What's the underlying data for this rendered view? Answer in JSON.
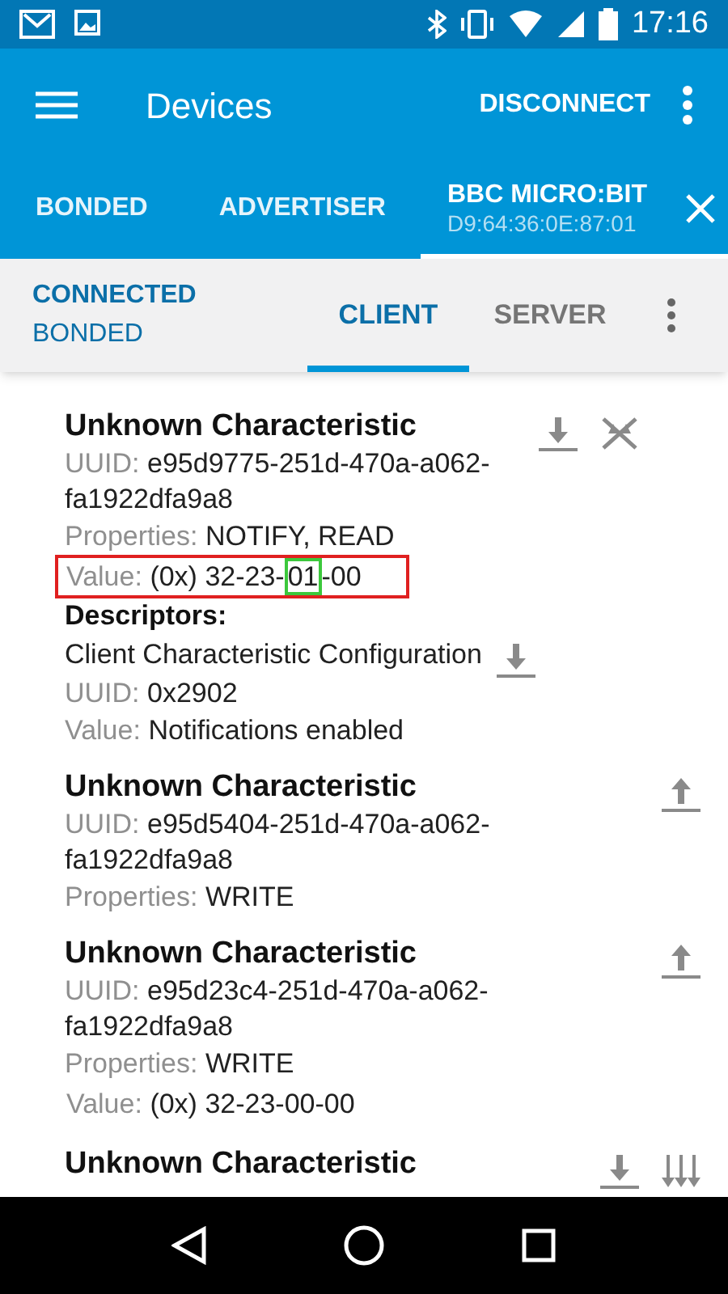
{
  "status_bar": {
    "time": "17:16"
  },
  "app_bar": {
    "title": "Devices",
    "action": "DISCONNECT"
  },
  "device_tabs": [
    {
      "label": "BONDED",
      "selected": false
    },
    {
      "label": "ADVERTISER",
      "selected": false
    },
    {
      "label": "BBC MICRO:BIT",
      "address": "D9:64:36:0E:87:01",
      "selected": true,
      "closable": true
    }
  ],
  "connection": {
    "state": "CONNECTED",
    "bond": "BONDED"
  },
  "tabs": [
    {
      "label": "CLIENT",
      "selected": true
    },
    {
      "label": "SERVER",
      "selected": false
    }
  ],
  "characteristics": [
    {
      "name": "Unknown Characteristic",
      "uuid_label": "UUID:",
      "uuid": "e95d9775-251d-470a-a062-fa1922dfa9a8",
      "properties_label": "Properties:",
      "properties": "NOTIFY, READ",
      "value_label": "Value:",
      "value_boxed": true,
      "value_parts": [
        {
          "text": "(0x) 32-23-",
          "marked": false
        },
        {
          "text": "01",
          "marked": true
        },
        {
          "text": "-00",
          "marked": false
        }
      ],
      "actions": [
        {
          "kind": "read"
        },
        {
          "kind": "notify_off"
        }
      ],
      "descriptors_label": "Descriptors:",
      "descriptors": [
        {
          "name": "Client Characteristic Configuration",
          "uuid_label": "UUID:",
          "uuid": "0x2902",
          "value_label": "Value:",
          "value": "Notifications enabled",
          "actions": [
            {
              "kind": "read"
            }
          ]
        }
      ]
    },
    {
      "name": "Unknown Characteristic",
      "uuid_label": "UUID:",
      "uuid": "e95d5404-251d-470a-a062-fa1922dfa9a8",
      "properties_label": "Properties:",
      "properties": "WRITE",
      "actions": [
        {
          "kind": "write"
        }
      ]
    },
    {
      "name": "Unknown Characteristic",
      "uuid_label": "UUID:",
      "uuid": "e95d23c4-251d-470a-a062-fa1922dfa9a8",
      "properties_label": "Properties:",
      "properties": "WRITE",
      "value_label": "Value:",
      "value_boxed": false,
      "value_parts": [
        {
          "text": "(0x) 32-23-00-00",
          "marked": false
        }
      ],
      "actions": [
        {
          "kind": "write"
        }
      ]
    },
    {
      "name": "Unknown Characteristic",
      "actions": [
        {
          "kind": "read"
        },
        {
          "kind": "notify"
        }
      ]
    }
  ]
}
